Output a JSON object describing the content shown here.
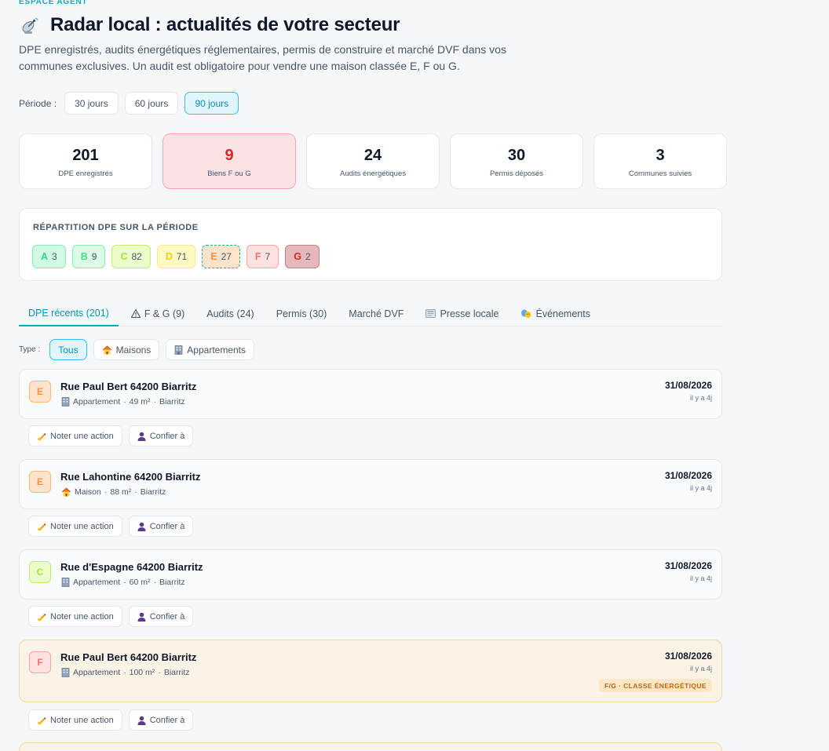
{
  "header": {
    "eyebrow": "ESPACE AGENT",
    "title": "Radar local : actualités de votre secteur",
    "subtitle": "DPE enregistrés, audits énergétiques réglementaires, permis de construire et marché DVF dans vos communes exclusives. Un audit est obligatoire pour vendre une maison classée E, F ou G."
  },
  "period": {
    "label": "Période :",
    "options": [
      "30 jours",
      "60 jours",
      "90 jours"
    ],
    "selected": "90 jours"
  },
  "stats": [
    {
      "value": "201",
      "label": "DPE enregistrés"
    },
    {
      "value": "9",
      "label": "Biens F ou G"
    },
    {
      "value": "24",
      "label": "Audits énergétiques"
    },
    {
      "value": "30",
      "label": "Permis déposés"
    },
    {
      "value": "3",
      "label": "Communes suivies"
    }
  ],
  "dpe_distribution": {
    "title": "RÉPARTITION DPE SUR LA PÉRIODE",
    "classes": [
      {
        "letter": "A",
        "count": "3",
        "color": "#34d399"
      },
      {
        "letter": "B",
        "count": "9",
        "color": "#4ade80"
      },
      {
        "letter": "C",
        "count": "82",
        "color": "#a3e635"
      },
      {
        "letter": "D",
        "count": "71",
        "color": "#facc15"
      },
      {
        "letter": "E",
        "count": "27",
        "color": "#fb923c"
      },
      {
        "letter": "F",
        "count": "7",
        "color": "#f87171"
      },
      {
        "letter": "G",
        "count": "2",
        "color": "#dc2626"
      }
    ]
  },
  "tabs": [
    {
      "label": "DPE récents (201)",
      "icon": ""
    },
    {
      "label": "F & G (9)",
      "icon": "warning-icon"
    },
    {
      "label": "Audits (24)",
      "icon": ""
    },
    {
      "label": "Permis (30)",
      "icon": ""
    },
    {
      "label": "Marché DVF",
      "icon": ""
    },
    {
      "label": "Presse locale",
      "icon": "newspaper-icon"
    },
    {
      "label": "Événements",
      "icon": "theater-masks-icon"
    }
  ],
  "type_filter": {
    "label": "Type :",
    "options": [
      "Tous",
      "Maisons",
      "Appartements"
    ],
    "selected": "Tous"
  },
  "listings": [
    {
      "class": "E",
      "address": "Rue Paul Bert 64200 Biarritz",
      "type": "Appartement",
      "surface": "49 m²",
      "city": "Biarritz",
      "date": "31/08/2026",
      "ago": "il y a 4j",
      "tag": ""
    },
    {
      "class": "E",
      "address": "Rue Lahontine 64200 Biarritz",
      "type": "Maison",
      "surface": "88 m²",
      "city": "Biarritz",
      "date": "31/08/2026",
      "ago": "il y a 4j",
      "tag": ""
    },
    {
      "class": "C",
      "address": "Rue d'Espagne 64200 Biarritz",
      "type": "Appartement",
      "surface": "60 m²",
      "city": "Biarritz",
      "date": "31/08/2026",
      "ago": "il y a 4j",
      "tag": ""
    },
    {
      "class": "F",
      "address": "Rue Paul Bert 64200 Biarritz",
      "type": "Appartement",
      "surface": "100 m²",
      "city": "Biarritz",
      "date": "31/08/2026",
      "ago": "il y a 4j",
      "tag": "F/G · CLASSE ÉNERGÉTIQUE"
    }
  ],
  "actions": {
    "note": "Noter une action",
    "assign": "Confier à"
  },
  "colors": {
    "accent": "#0ea5c9",
    "alert": "#dc2626",
    "warning_tag": "#c2670c"
  }
}
